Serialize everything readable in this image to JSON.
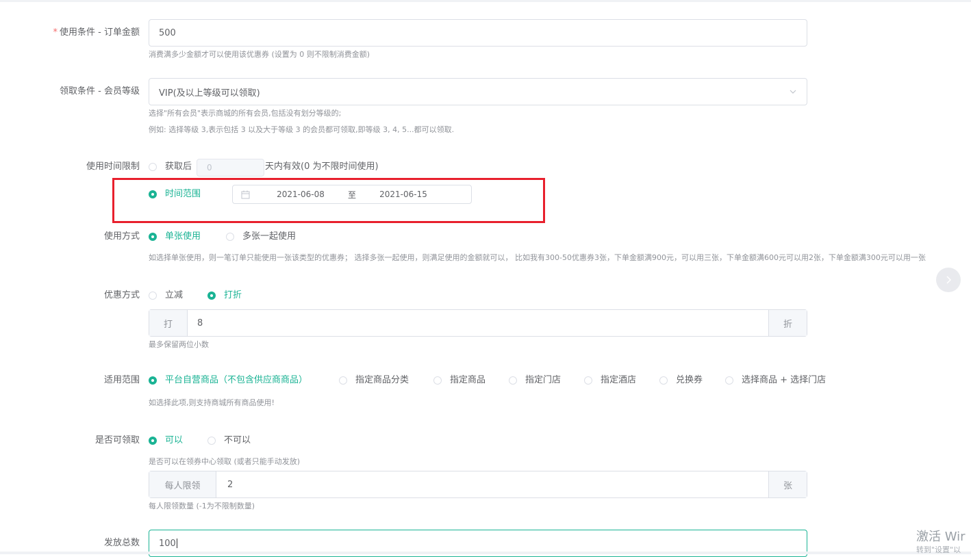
{
  "order_amount": {
    "label": "使用条件 - 订单金额",
    "required_mark": "*",
    "value": "500",
    "hint": "消费满多少金额才可以使用该优惠券 (设置为 0 则不限制消费金额)"
  },
  "member_level": {
    "label": "领取条件 - 会员等级",
    "value": "VIP(及以上等级可以领取)",
    "hint1": "选择\"所有会员\"表示商城的所有会员,包括没有划分等级的;",
    "hint2": "例如: 选择等级 3,表示包括 3 以及大于等级 3 的会员都可领取,即等级 3, 4, 5...都可以领取."
  },
  "time_limit": {
    "label": "使用时间限制",
    "option_days_prefix": "获取后",
    "days_placeholder": "0",
    "option_days_suffix": "天内有效(0 为不限时间使用)",
    "option_range": "时间范围",
    "range_start": "2021-06-08",
    "range_sep": "至",
    "range_end": "2021-06-15",
    "selected": "时间范围"
  },
  "usage": {
    "label": "使用方式",
    "options": [
      "单张使用",
      "多张一起使用"
    ],
    "selected": "单张使用",
    "hint": "如选择单张使用，则一笔订单只能使用一张该类型的优惠券； 选择多张一起使用，则满足使用的金额就可以， 比如我有300-50优惠券3张，下单金额满900元，可以用三张，下单金额满600元可以用2张，下单金额满300元可以用一张"
  },
  "discount": {
    "label": "优惠方式",
    "options": [
      "立减",
      "打折"
    ],
    "selected": "打折",
    "prefix": "打",
    "value": "8",
    "suffix": "折",
    "hint": "最多保留两位小数"
  },
  "scope": {
    "label": "适用范围",
    "options": [
      "平台自营商品（不包含供应商商品）",
      "指定商品分类",
      "指定商品",
      "指定门店",
      "指定酒店",
      "兑换券",
      "选择商品 + 选择门店"
    ],
    "selected": "平台自营商品（不包含供应商商品）",
    "hint": "如选择此项,则支持商城所有商品使用!"
  },
  "claimable": {
    "label": "是否可领取",
    "options": [
      "可以",
      "不可以"
    ],
    "selected": "可以",
    "hint": "是否可以在领券中心领取 (或者只能手动发放)",
    "limit_prefix": "每人限领",
    "limit_value": "2",
    "limit_suffix": "张",
    "limit_hint": "每人限领数量 (-1为不限制数量)"
  },
  "total": {
    "label": "发放总数",
    "value": "100"
  },
  "nav": {
    "next_icon": "chevron-right-icon"
  },
  "watermark": {
    "line1": "激活 Wir",
    "line2": "转到\"设置\"以"
  },
  "colors": {
    "accent": "#1ab394",
    "highlight_box": "#e8202d",
    "required": "#f56c6c"
  }
}
